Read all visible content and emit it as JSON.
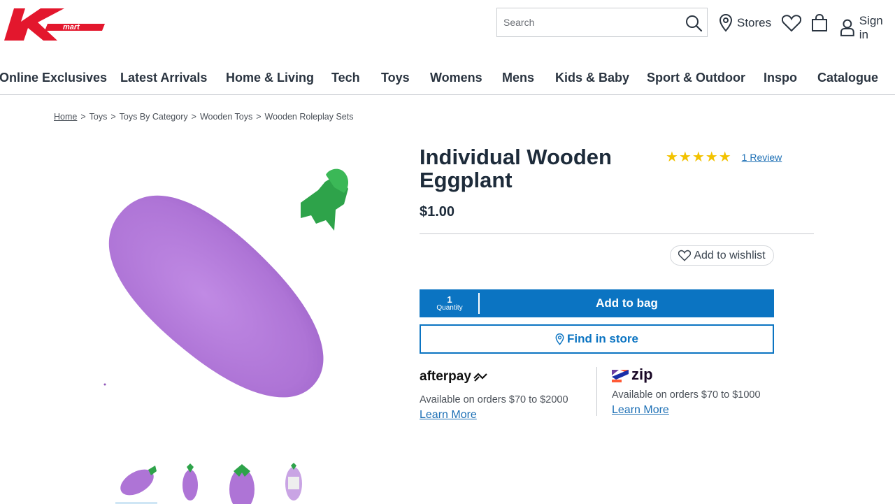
{
  "header": {
    "logo_text": "mart",
    "search_placeholder": "Search",
    "stores_label": "Stores",
    "signin_label": "Sign in"
  },
  "nav": [
    "Online Exclusives",
    "Latest Arrivals",
    "Home & Living",
    "Tech",
    "Toys",
    "Womens",
    "Mens",
    "Kids & Baby",
    "Sport & Outdoor",
    "Inspo",
    "Catalogue"
  ],
  "breadcrumb": [
    "Home",
    "Toys",
    "Toys By Category",
    "Wooden Toys",
    "Wooden Roleplay Sets"
  ],
  "product": {
    "title_line1": "Individual Wooden",
    "title_line2": "Eggplant",
    "rating": 5,
    "stars": "★★★★★",
    "review_link": "1 Review",
    "price": "$1.00",
    "wishlist_label": "Add to wishlist",
    "quantity_value": "1",
    "quantity_label": "Quantity",
    "add_to_bag_label": "Add to bag",
    "find_in_store_label": "Find in store"
  },
  "payments": {
    "afterpay": {
      "brand": "afterpay",
      "text": "Available on orders $70 to $2000",
      "link": "Learn More"
    },
    "zip": {
      "brand": "zip",
      "text": "Available on orders $70 to $1000",
      "link": "Learn More"
    }
  },
  "colors": {
    "brand_red": "#e3172d",
    "primary_blue": "#0b74c2",
    "star_yellow": "#f2c200",
    "eggplant_purple": "#b07ad8",
    "stem_green": "#2ea34a"
  }
}
